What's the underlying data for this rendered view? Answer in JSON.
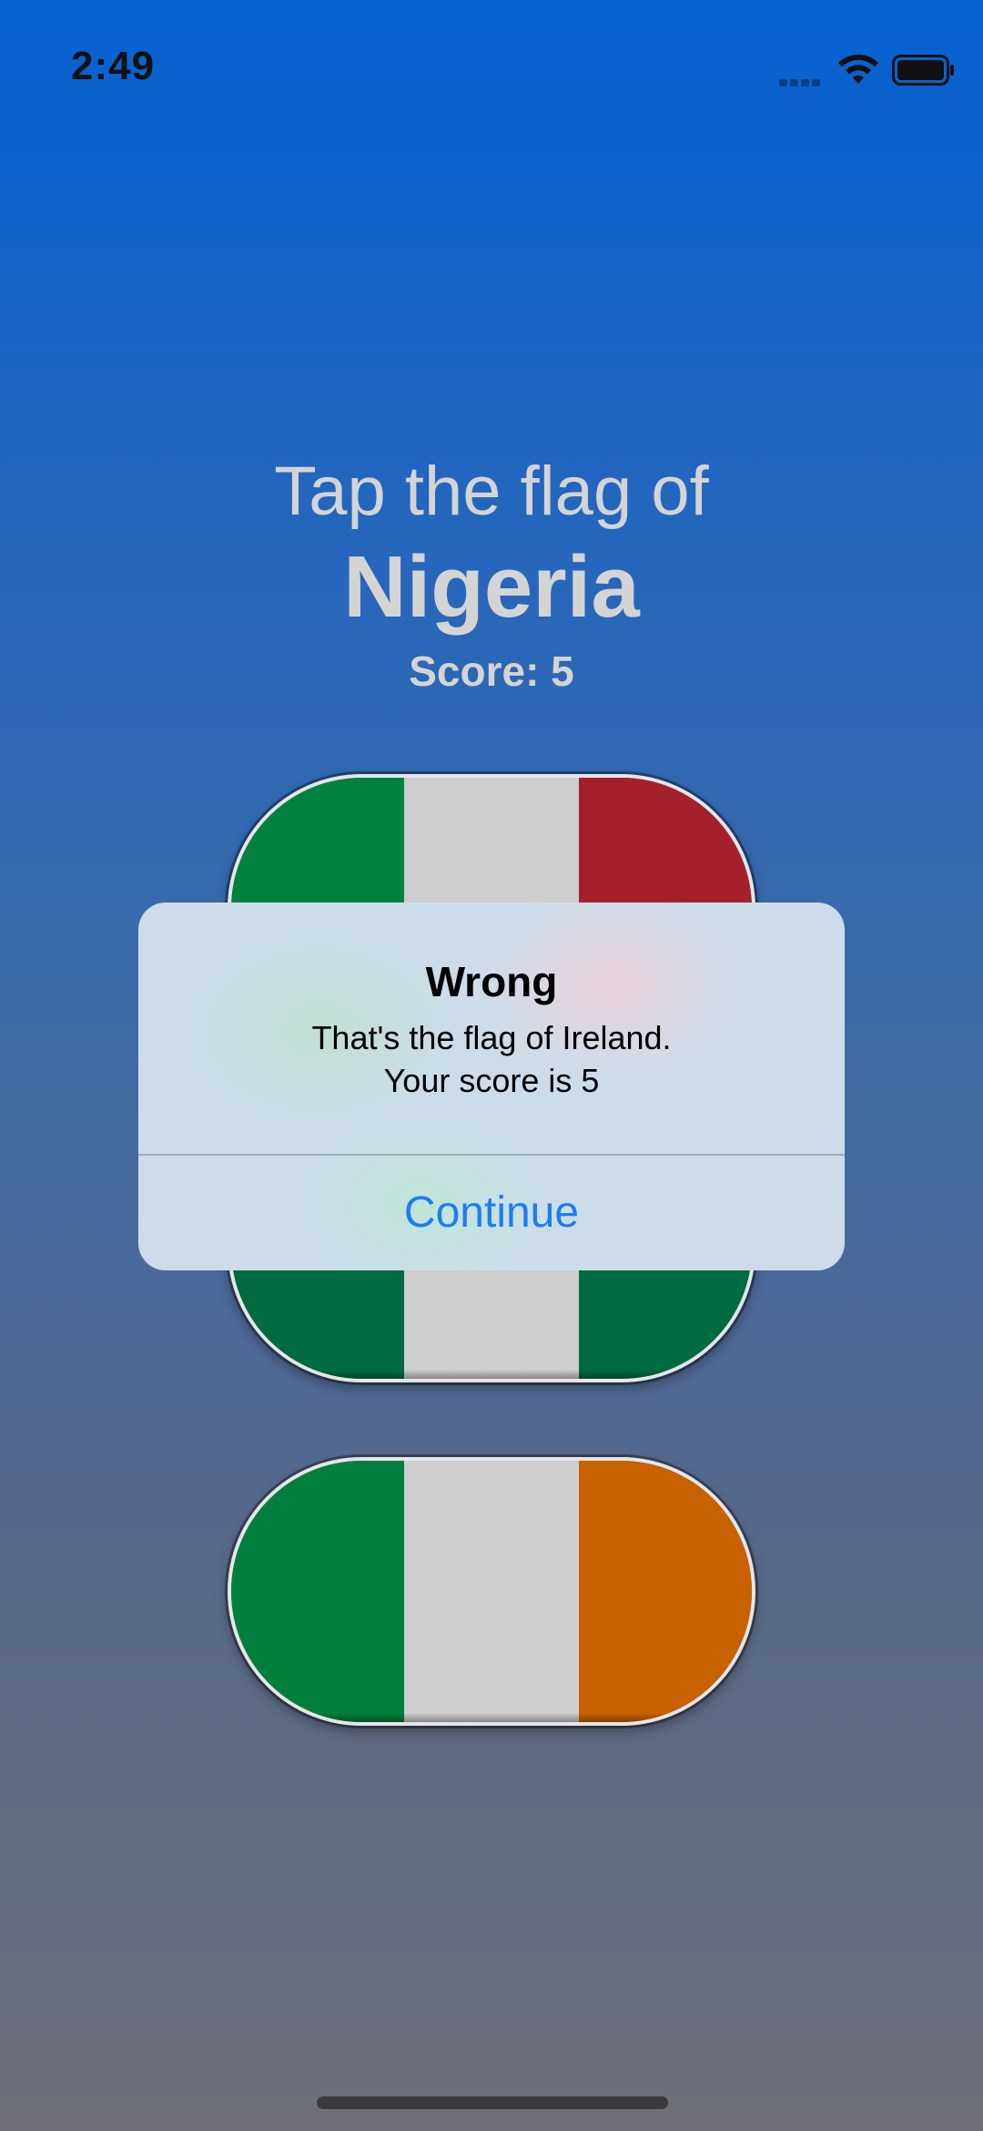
{
  "status_bar": {
    "time": "2:49"
  },
  "header": {
    "prompt": "Tap the flag of",
    "country": "Nigeria",
    "score": "Score: 5"
  },
  "flags": [
    {
      "name": "italy-flag-button",
      "colors": [
        "#00813f",
        "#cecece",
        "#a4212b"
      ]
    },
    {
      "name": "nigeria-flag-button",
      "colors": [
        "#006a40",
        "#cecece",
        "#006a40"
      ]
    },
    {
      "name": "ireland-flag-button",
      "colors": [
        "#007f3c",
        "#cecece",
        "#c86100"
      ]
    }
  ],
  "alert": {
    "title": "Wrong",
    "message_line1": "That's the flag of Ireland.",
    "message_line2": "Your score is 5",
    "button_label": "Continue",
    "button_color": "#1a7ef2"
  }
}
